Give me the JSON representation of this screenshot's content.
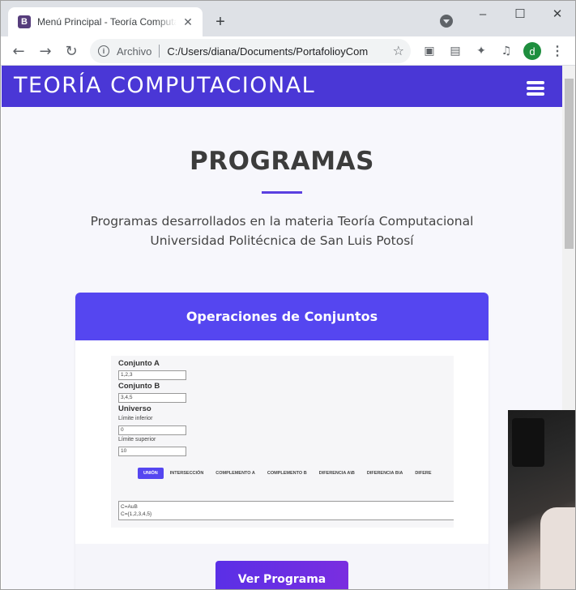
{
  "browser": {
    "tab": {
      "favicon_letter": "B",
      "title": "Menú Principal - Teoría Computacional",
      "close_glyph": "✕"
    },
    "new_tab_glyph": "+",
    "window_controls": {
      "minimize": "–",
      "maximize": "☐",
      "close": "✕"
    },
    "address": {
      "security_chip": "Archivo",
      "url": "C:/Users/diana/Documents/PortafolioyCom"
    },
    "profile_initial": "d",
    "accent": "#1e8e3e"
  },
  "site": {
    "brand": "TEORÍA COMPUTACIONAL",
    "nav_color": "#4a37d6",
    "section_title": "PROGRAMAS",
    "subtitle_line1": "Programas desarrollados en la materia Teoría Computacional",
    "subtitle_line2": "Universidad Politécnica de San Luis Potosí",
    "card": {
      "title": "Operaciones de Conjuntos",
      "button_label": "Ver Programa",
      "preview": {
        "set_a_label": "Conjunto A",
        "set_a_value": "1,2,3",
        "set_b_label": "Conjunto B",
        "set_b_value": "3,4,5",
        "universe_label": "Universo",
        "lower_label": "Límite inferior",
        "lower_value": "0",
        "upper_label": "Límite superior",
        "upper_value": "10",
        "tabs": [
          "UNIÓN",
          "INTERSECCIÓN",
          "COMPLEMENTO A",
          "COMPLEMENTO B",
          "DIFERENCIA A\\B",
          "DIFERENCIA B\\A",
          "DIFERE"
        ],
        "output_line1": "C=AuB",
        "output_line2": "C={1,2,3,4,5}"
      }
    }
  }
}
